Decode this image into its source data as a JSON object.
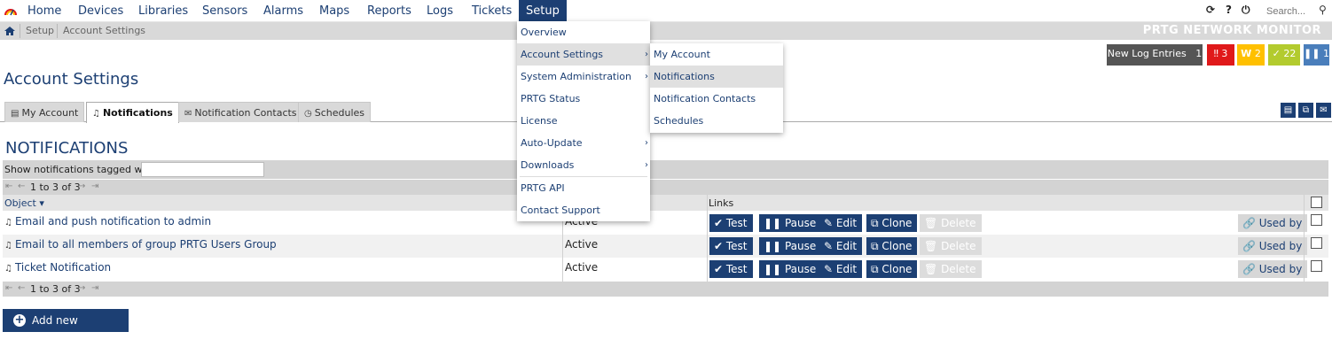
{
  "nav": {
    "items": [
      "Home",
      "Devices",
      "Libraries",
      "Sensors",
      "Alarms",
      "Maps",
      "Reports",
      "Logs",
      "Tickets",
      "Setup"
    ],
    "search_placeholder": "Search...",
    "icons": [
      "refresh-icon",
      "help-icon",
      "logout-icon",
      "search-icon"
    ]
  },
  "breadcrumb": {
    "items": [
      "Setup",
      "Account Settings"
    ],
    "brand": "PRTG NETWORK MONITOR"
  },
  "counters": {
    "new_log_label": "New Log Entries",
    "new_log_count": "1",
    "down": "3",
    "warning": "2",
    "up": "22",
    "paused": "1",
    "colors": {
      "down": "#e0191a",
      "warning": "#ffc000",
      "up": "#b3cb2e",
      "paused": "#4a7ebb",
      "log": "#555555"
    }
  },
  "page": {
    "title": "Account Settings"
  },
  "tabs": [
    "My Account",
    "Notifications",
    "Notification Contacts",
    "Schedules"
  ],
  "section": {
    "title": "NOTIFICATIONS",
    "filter_label": "Show notifications tagged with",
    "filter_value": "",
    "pager": "1 to 3 of 3"
  },
  "table": {
    "headers": {
      "object": "Object",
      "links": "Links"
    },
    "rows": [
      {
        "name": "Email and push notification to admin",
        "status": "Active"
      },
      {
        "name": "Email to all members of group PRTG Users Group",
        "status": "Active"
      },
      {
        "name": "Ticket Notification",
        "status": "Active"
      }
    ],
    "actions": {
      "test": "Test",
      "pause": "Pause",
      "edit": "Edit",
      "clone": "Clone",
      "delete": "Delete",
      "used_by": "Used by"
    }
  },
  "add_button": "Add new notification",
  "setup_menu": [
    "Overview",
    "Account Settings",
    "System Administration",
    "PRTG Status",
    "License",
    "Auto-Update",
    "Downloads",
    "PRTG API",
    "Contact Support"
  ],
  "account_submenu": [
    "My Account",
    "Notifications",
    "Notification Contacts",
    "Schedules"
  ],
  "accent": "#1c3f73"
}
